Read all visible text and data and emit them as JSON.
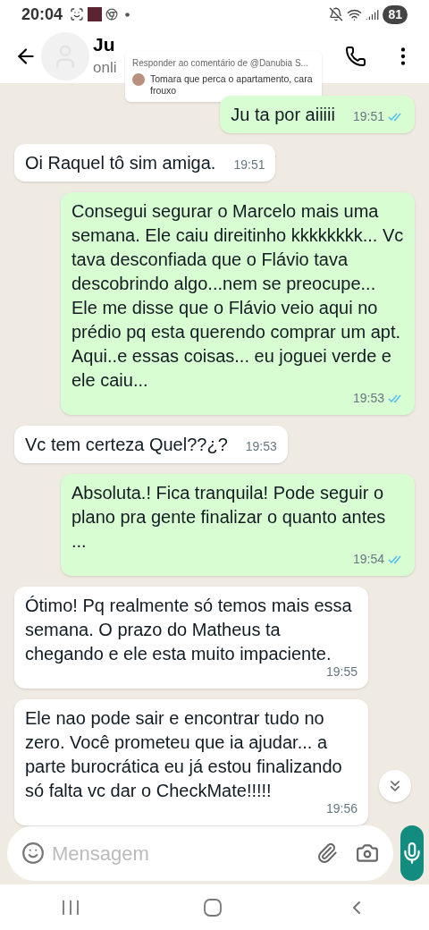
{
  "status_bar": {
    "time": "20:04",
    "battery": "81"
  },
  "header": {
    "name": "Ju",
    "status": "onli"
  },
  "reply_popup": {
    "title": "Responder ao comentário de @Danubia S...",
    "comment": "Tomara que perca o apartamento, cara frouxo"
  },
  "messages": [
    {
      "kind": "sent",
      "text": "Ju ta por aiiiii",
      "time": "19:51",
      "read": true
    },
    {
      "kind": "received",
      "text": "Oi Raquel tô sim amiga.",
      "time": "19:51"
    },
    {
      "kind": "sent",
      "text": "Consegui segurar o Marcelo mais uma semana. Ele caiu direitinho kkkkkkkk... Vc tava desconfiada que o Flávio tava descobrindo algo...nem se preocupe... Ele me disse que o Flávio veio aqui no prédio pq esta querendo comprar um apt. Aqui..e essas coisas... eu joguei verde e ele caiu...",
      "time": "19:53",
      "read": true
    },
    {
      "kind": "received",
      "text": "Vc tem certeza Quel??¿?",
      "time": "19:53"
    },
    {
      "kind": "sent",
      "text": "Absoluta.! Fica tranquila! Pode seguir o plano pra gente finalizar o quanto antes ...",
      "time": "19:54",
      "read": true
    },
    {
      "kind": "received",
      "text": "Ótimo! Pq realmente só temos mais essa semana. O prazo do Matheus ta chegando e ele esta muito impaciente.",
      "time": "19:55"
    },
    {
      "kind": "received",
      "text": "Ele nao pode sair e encontrar tudo no zero. Você prometeu que ia ajudar... a parte burocrática eu já estou finalizando só falta vc dar o CheckMate!!!!!",
      "time": "19:56"
    }
  ],
  "composer": {
    "placeholder": "Mensagem"
  }
}
